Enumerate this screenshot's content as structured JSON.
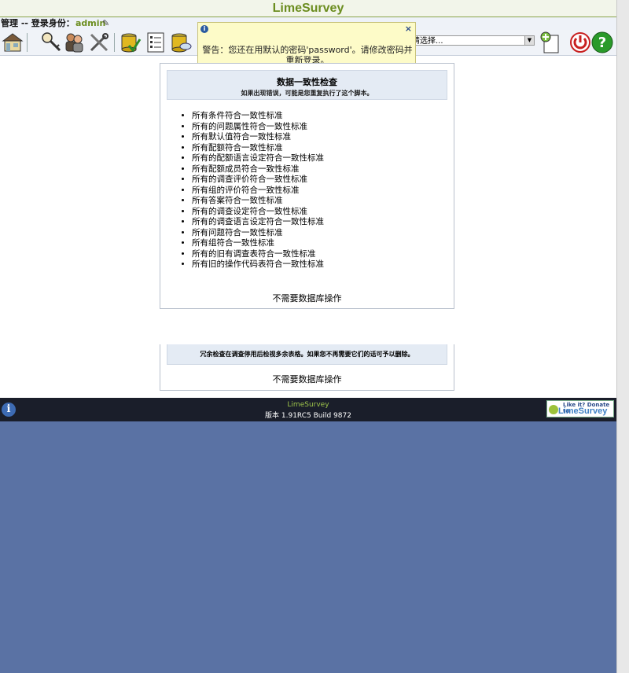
{
  "header": {
    "title": "LimeSurvey"
  },
  "userbar": {
    "admin_label": "管理  -- 登录身份：",
    "username": "admin"
  },
  "toolbar": {
    "buttons": [
      "home-icon",
      "key-icon",
      "users-icon",
      "tools-icon",
      "database-check-icon",
      "checklist-icon",
      "database-sql-icon",
      "add-survey-icon",
      "logout-icon",
      "help-icon"
    ],
    "select_value": "请选择..."
  },
  "warning": {
    "message": "警告：您还在用默认的密码'password'。请修改密码并重新登录。"
  },
  "consistency": {
    "title": "数据一致性检查",
    "subtitle": "如果出现错误，可能是您重复执行了这个脚本。",
    "items": [
      "所有条件符合一致性标准",
      "所有的问题属性符合一致性标准",
      "所有默认值符合一致性标准",
      "所有配额符合一致性标准",
      "所有的配额语言设定符合一致性标准",
      "所有配额成员符合一致性标准",
      "所有的调查评价符合一致性标准",
      "所有组的评价符合一致性标准",
      "所有答案符合一致性标准",
      "所有的调查设定符合一致性标准",
      "所有的调查语言设定符合一致性标准",
      "所有问题符合一致性标准",
      "所有组符合一致性标准",
      "所有的旧有调查表符合一致性标准",
      "所有旧的操作代码表符合一致性标准"
    ],
    "no_action": "不需要数据库操作"
  },
  "redundancy": {
    "subtitle": "冗余检查在调查停用后检视多余表格。如果您不再需要它们的话可予以删除。",
    "no_action": "不需要数据库操作"
  },
  "footer": {
    "app_name": "LimeSurvey",
    "version": "版本 1.91RC5 Build 9872",
    "donate_line1": "Like it? Donate to",
    "donate_line2": "LimeSurvey"
  }
}
